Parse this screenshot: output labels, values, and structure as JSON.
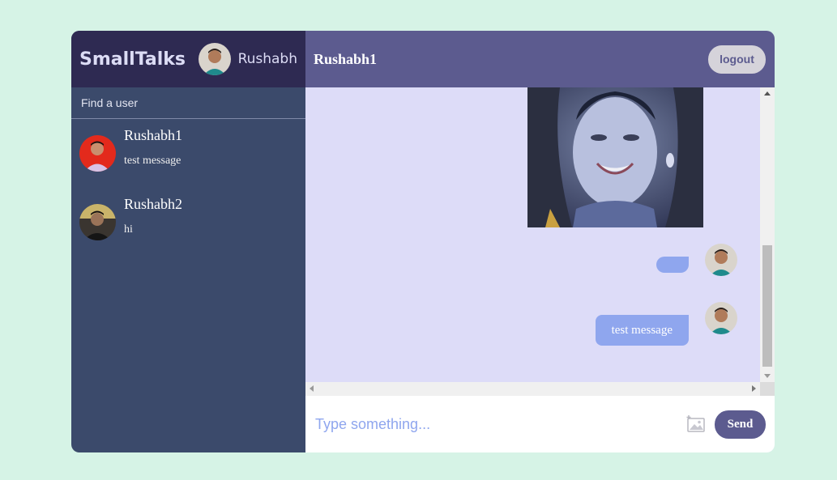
{
  "sidebar": {
    "brand": "SmallTalks",
    "current_user": "Rushabh",
    "search_placeholder": "Find a user",
    "chats": [
      {
        "name": "Rushabh1",
        "last_message": "test message"
      },
      {
        "name": "Rushabh2",
        "last_message": "hi"
      }
    ]
  },
  "chat": {
    "title": "Rushabh1",
    "logout_label": "logout",
    "messages": [
      {
        "type": "image",
        "icon": "portrait-image"
      },
      {
        "type": "text",
        "text": ""
      },
      {
        "type": "text",
        "text": "test message"
      }
    ],
    "input_placeholder": "Type something...",
    "send_label": "Send"
  },
  "colors": {
    "page_bg": "#d6f3e6",
    "sidebar_header": "#2e2a52",
    "sidebar_bg": "#3b4a6b",
    "chat_header": "#5c5b8f",
    "chat_bg": "#dddcf8",
    "bubble": "#8fa6ee"
  }
}
